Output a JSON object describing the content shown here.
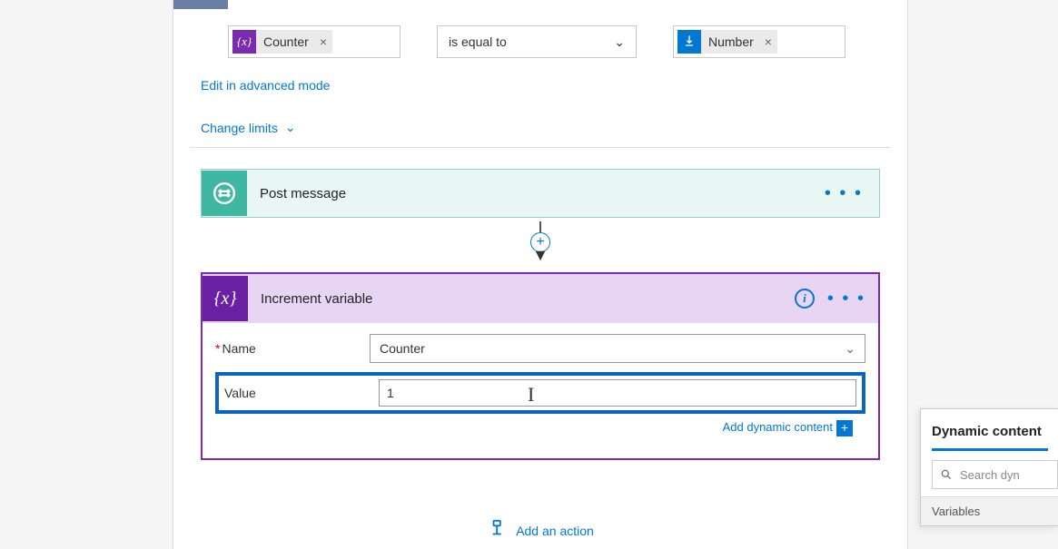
{
  "condition": {
    "left_token": {
      "icon": "{x}",
      "label": "Counter"
    },
    "operator": "is equal to",
    "right_token": {
      "icon": "hand",
      "label": "Number"
    }
  },
  "links": {
    "advanced": "Edit in advanced mode",
    "limits": "Change limits"
  },
  "post_message": {
    "title": "Post message"
  },
  "increment": {
    "title": "Increment variable",
    "name_label": "Name",
    "name_value": "Counter",
    "value_label": "Value",
    "value_value": "1",
    "add_dynamic": "Add dynamic content"
  },
  "add_action": "Add an action",
  "dynamic_panel": {
    "header": "Dynamic content",
    "search_placeholder": "Search dyn",
    "section": "Variables"
  }
}
